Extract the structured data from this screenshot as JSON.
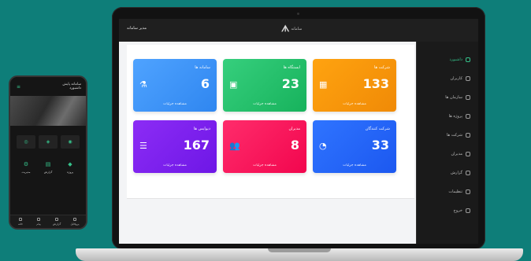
{
  "laptop": {
    "topbar": {
      "user": "مدیر سامانه",
      "brand_mark": "ᗑ",
      "brand_name": "سامانه"
    },
    "sidebar": {
      "items": [
        {
          "label": "داشبورد",
          "active": true
        },
        {
          "label": "کاربران",
          "active": false
        },
        {
          "label": "سازمان ها",
          "active": false
        },
        {
          "label": "پروژه ها",
          "active": false
        },
        {
          "label": "شرکت ها",
          "active": false
        },
        {
          "label": "مدیران",
          "active": false
        },
        {
          "label": "گزارش",
          "active": false
        },
        {
          "label": "تنظیمات",
          "active": false
        },
        {
          "label": "خروج",
          "active": false
        }
      ]
    },
    "cards": [
      {
        "title": "شرکت ها",
        "value": "133",
        "more": "مشاهده جزئیات",
        "color_from": "#ffa310",
        "color_to": "#f08a06",
        "icon": "building-icon",
        "glyph": "▦"
      },
      {
        "title": "ایستگاه ها",
        "value": "23",
        "more": "مشاهده جزئیات",
        "color_from": "#36cf7d",
        "color_to": "#17b25c",
        "icon": "device-icon",
        "glyph": "▣"
      },
      {
        "title": "سامانه ها",
        "value": "6",
        "more": "مشاهده جزئیات",
        "color_from": "#4fa3ff",
        "color_to": "#2f86f0",
        "icon": "flask-icon",
        "glyph": "⚗"
      },
      {
        "title": "شرکت کنندگان",
        "value": "33",
        "more": "مشاهده جزئیات",
        "color_from": "#2f74ff",
        "color_to": "#1c58f0",
        "icon": "pie-chart-icon",
        "glyph": "◔"
      },
      {
        "title": "مدیران",
        "value": "8",
        "more": "مشاهده جزئیات",
        "color_from": "#ff2c6b",
        "color_to": "#f2064e",
        "icon": "users-icon",
        "glyph": "👥"
      },
      {
        "title": "دیوایس ها",
        "value": "167",
        "more": "مشاهده جزئیات",
        "color_from": "#8c2cf5",
        "color_to": "#6e17e6",
        "icon": "server-icon",
        "glyph": "☰"
      }
    ]
  },
  "phone": {
    "title": "سامانه پایش",
    "subtitle": "داشبورد",
    "tiles": [
      "◎",
      "◈",
      "◉"
    ],
    "buttons": [
      {
        "label": "مدیریت",
        "glyph": "⚙"
      },
      {
        "label": "گزارش",
        "glyph": "▤"
      },
      {
        "label": "پروژه",
        "glyph": "◆"
      }
    ],
    "nav": [
      "خانه",
      "پیام",
      "گزارش",
      "پروفایل"
    ]
  }
}
